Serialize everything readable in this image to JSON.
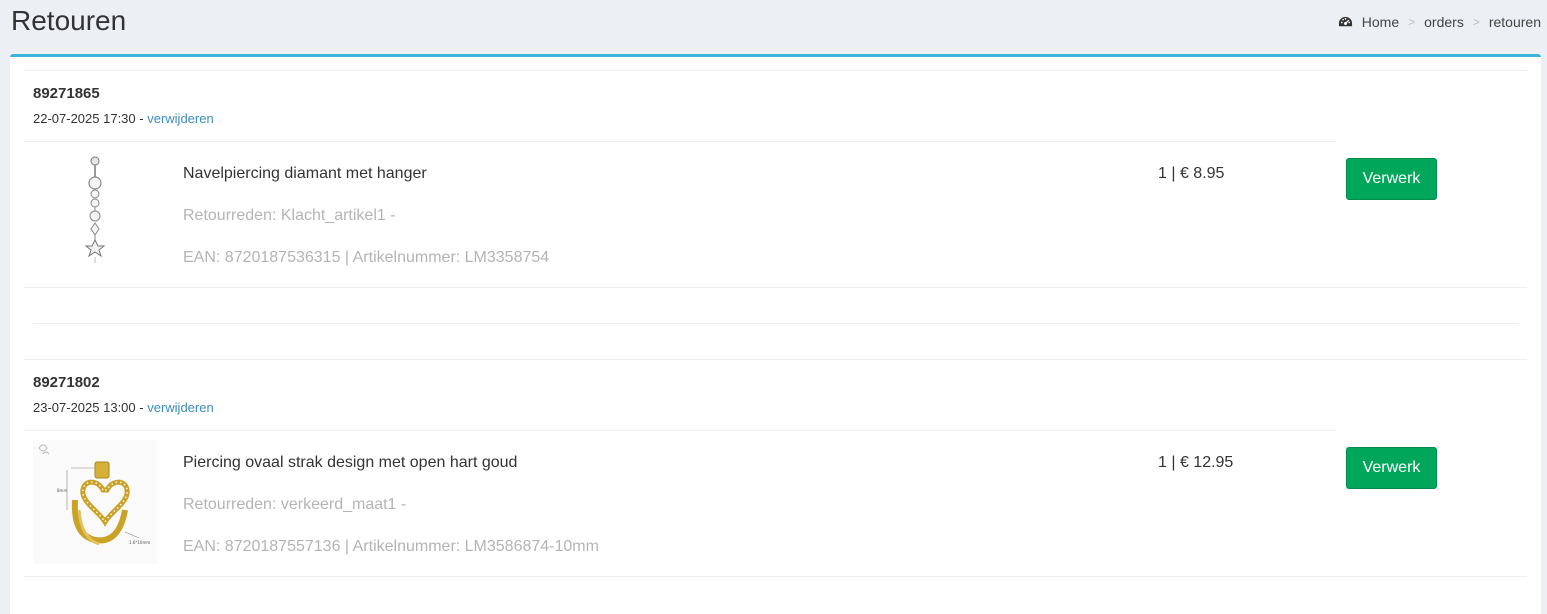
{
  "header": {
    "title": "Retouren",
    "breadcrumb": {
      "home": "Home",
      "orders": "orders",
      "current": "retouren",
      "separator": ">"
    }
  },
  "orders": [
    {
      "number": "89271865",
      "datetime": "22-07-2025 17:30",
      "meta_sep": " - ",
      "delete_label": "verwijderen",
      "product": {
        "image_icon": "belly-piercing-image",
        "name": "Navelpiercing diamant met hanger",
        "reason": "Retourreden: Klacht_artikel1 -",
        "ean": "EAN: 8720187536315 | Artikelnummer: LM3358754",
        "qty_price": "1 | € 8.95"
      },
      "action_label": "Verwerk"
    },
    {
      "number": "89271802",
      "datetime": "23-07-2025 13:00",
      "meta_sep": " - ",
      "delete_label": "verwijderen",
      "product": {
        "image_icon": "heart-ring-image",
        "name": "Piercing ovaal strak design met open hart goud",
        "reason": "Retourreden: verkeerd_maat1 -",
        "ean": "EAN: 8720187557136 | Artikelnummer: LM3586874-10mm",
        "qty_price": "1 | € 12.95"
      },
      "action_label": "Verwerk"
    }
  ],
  "colors": {
    "accent": "#3cb5dc",
    "button": "#00a65a",
    "link": "#3c8dbc",
    "muted_text": "#b4b4b4",
    "background": "#ecf0f5"
  }
}
